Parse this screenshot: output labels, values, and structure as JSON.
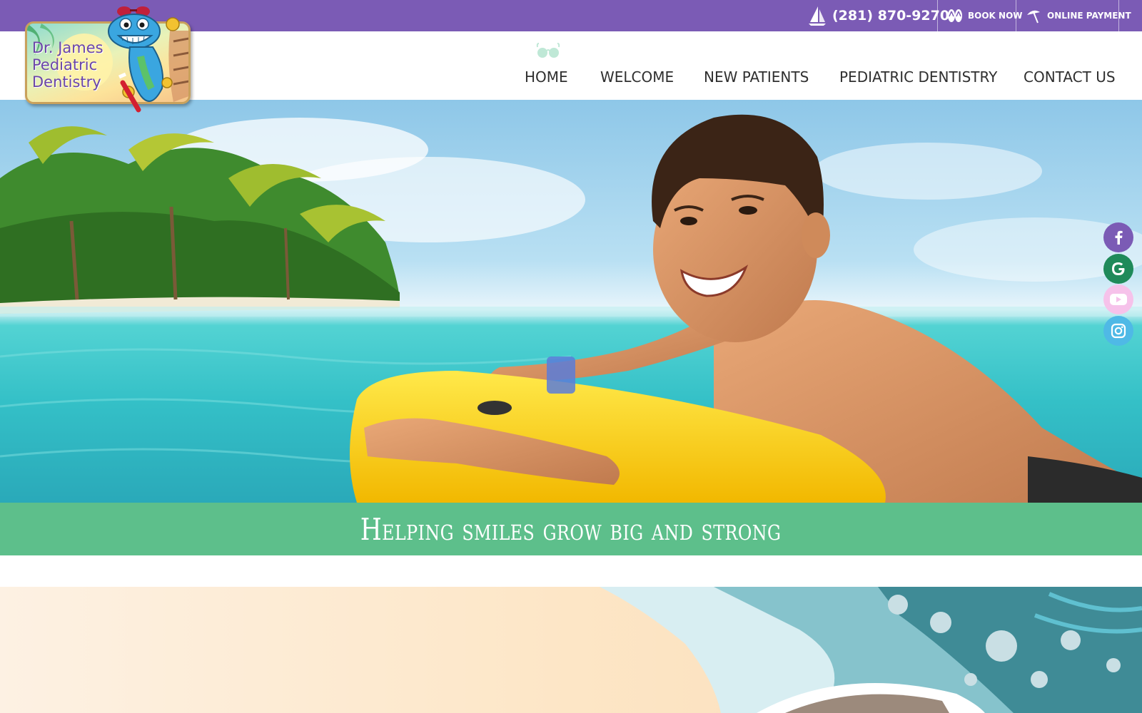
{
  "topbar": {
    "phone": "(281) 870-9270",
    "book_now": "BOOK NOW",
    "online_payment": "ONLINE PAYMENT",
    "icons": {
      "phone": "sailboat-icon",
      "book": "flip-flops-icon",
      "payment": "beach-umbrella-icon"
    }
  },
  "logo": {
    "line1": "Dr. James",
    "line2": "Pediatric",
    "line3": "Dentistry"
  },
  "nav": {
    "items": [
      {
        "label": "HOME",
        "active": true
      },
      {
        "label": "WELCOME"
      },
      {
        "label": "NEW PATIENTS"
      },
      {
        "label": "PEDIATRIC DENTISTRY"
      },
      {
        "label": "CONTACT US"
      }
    ],
    "active_icon": "sunglasses-icon"
  },
  "hero": {
    "tagline": "Helping smiles grow big and strong"
  },
  "social": [
    "facebook-icon",
    "google-icon",
    "youtube-icon",
    "instagram-icon"
  ],
  "colors": {
    "topbar": "#7b5bb5",
    "banner": "#5dbf8b",
    "facebook": "#7b5bb5",
    "google": "#1f8a5a",
    "youtube": "#f6c2ea",
    "instagram": "#4fb9e6"
  }
}
